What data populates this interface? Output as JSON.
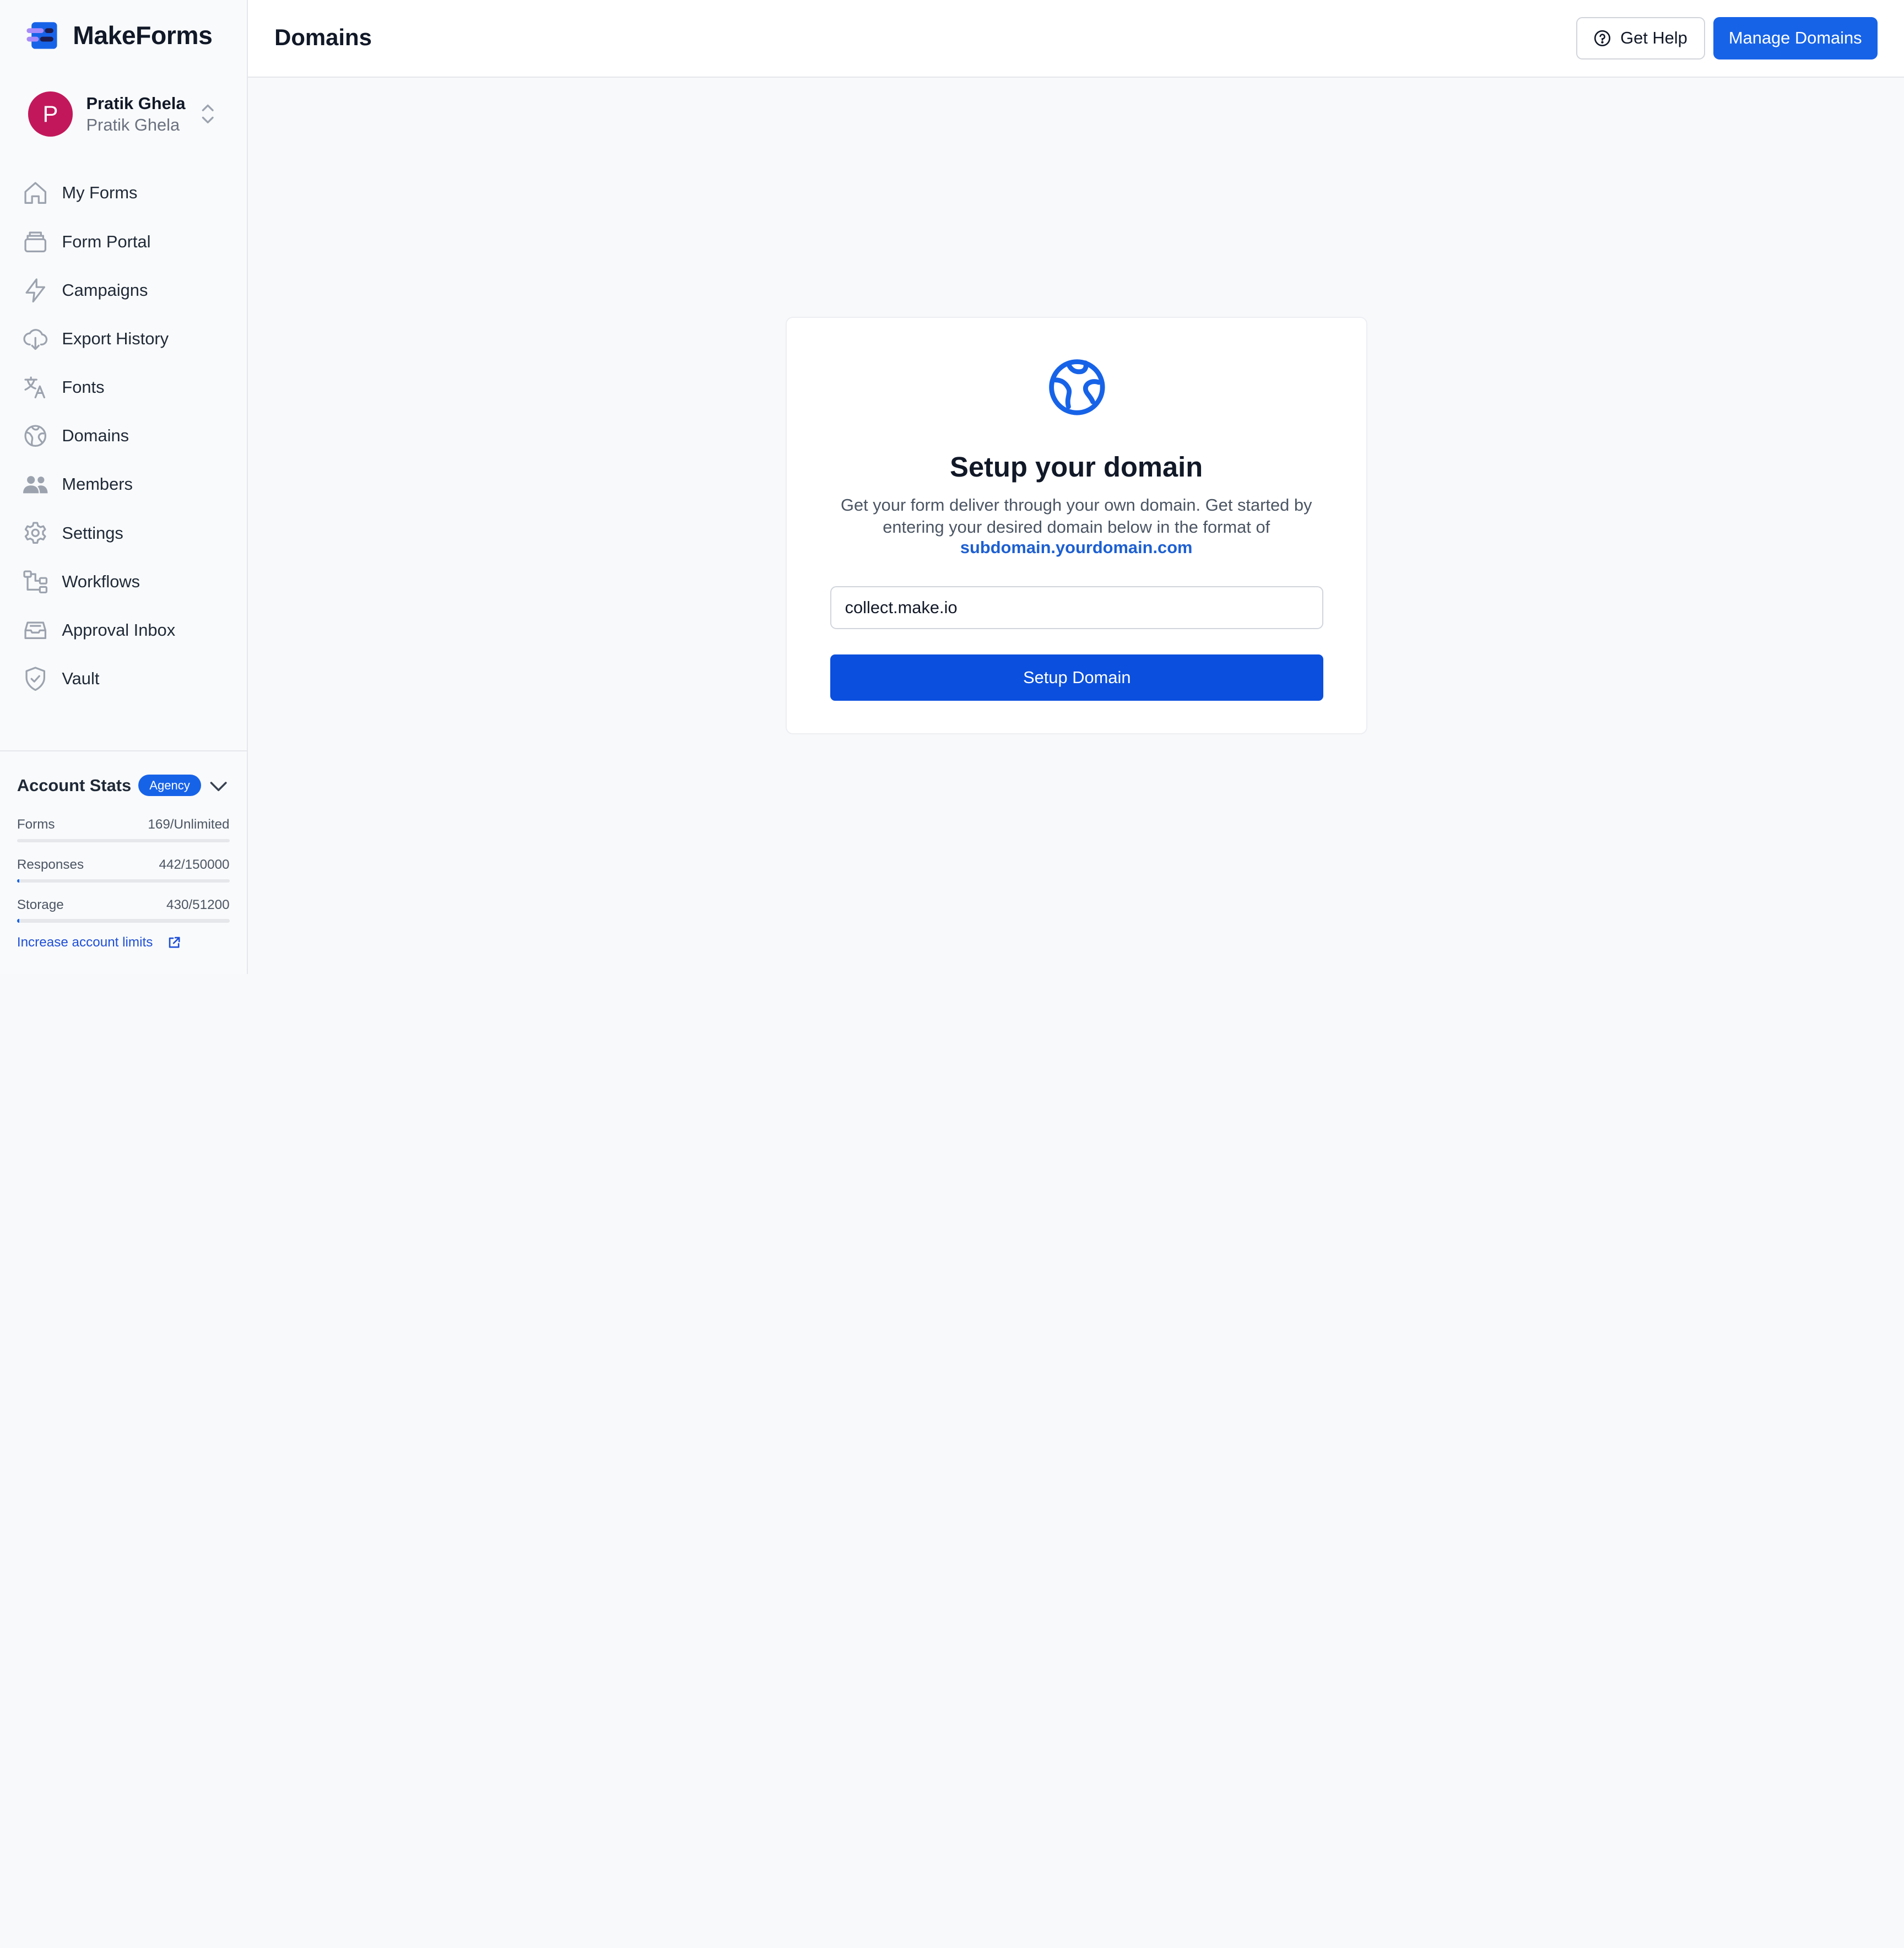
{
  "app": {
    "name": "MakeForms"
  },
  "account": {
    "initial": "P",
    "name": "Pratik Ghela",
    "workspace": "Pratik Ghela"
  },
  "nav": [
    {
      "label": "My Forms",
      "icon": "home-icon"
    },
    {
      "label": "Form Portal",
      "icon": "portal-icon"
    },
    {
      "label": "Campaigns",
      "icon": "lightning-icon"
    },
    {
      "label": "Export History",
      "icon": "cloud-download-icon"
    },
    {
      "label": "Fonts",
      "icon": "translate-icon"
    },
    {
      "label": "Domains",
      "icon": "globe-icon"
    },
    {
      "label": "Members",
      "icon": "users-icon"
    },
    {
      "label": "Settings",
      "icon": "gear-icon"
    },
    {
      "label": "Workflows",
      "icon": "workflow-icon"
    },
    {
      "label": "Approval Inbox",
      "icon": "inbox-icon"
    },
    {
      "label": "Vault",
      "icon": "shield-icon"
    }
  ],
  "stats": {
    "title": "Account Stats",
    "plan_badge": "Agency",
    "rows": [
      {
        "label": "Forms",
        "value": "169/Unlimited",
        "fill_fraction": 0.0
      },
      {
        "label": "Responses",
        "value": "442/150000",
        "fill_fraction": 0.003
      },
      {
        "label": "Storage",
        "value": "430/51200",
        "fill_fraction": 0.008
      }
    ],
    "increase_link": "Increase account limits"
  },
  "header": {
    "title": "Domains",
    "help_label": "Get Help",
    "manage_label": "Manage Domains"
  },
  "setup": {
    "title": "Setup your domain",
    "description": "Get your form deliver through your own domain. Get started by entering your desired domain below in the format of",
    "format_example": "subdomain.yourdomain.com",
    "input_value": "collect.make.io",
    "button_label": "Setup Domain"
  },
  "colors": {
    "accent": "#1763e8",
    "avatar": "#c2185b",
    "setup_button": "#0b4fde"
  }
}
